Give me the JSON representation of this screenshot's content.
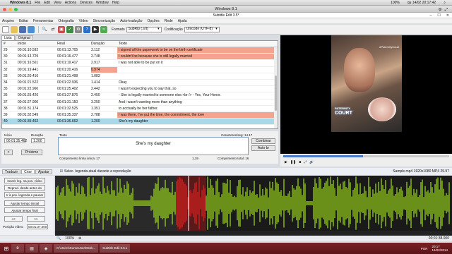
{
  "mac_menu": {
    "app": "Windows 8.1",
    "items": [
      "File",
      "Edit",
      "View",
      "Actions",
      "Devices",
      "Window",
      "Help"
    ],
    "clock": "qu 14/02 20:17:42",
    "battery": "100%"
  },
  "vm_title": "Windows 8.1",
  "window_title": "Subtitle Edit 3.5*",
  "menu": [
    "Arquivo",
    "Editar",
    "Ferramentas",
    "Ortografia",
    "Vídeo",
    "Sincronização",
    "Auto-tradução",
    "Opções",
    "Rede",
    "Ajuda"
  ],
  "toolbar": {
    "format_label": "Formato",
    "format_value": "SubRip (.srt)",
    "encoding_label": "Codificação",
    "encoding_value": "Unicode (UTF-8)"
  },
  "tabs": [
    "Lista",
    "Original"
  ],
  "grid": {
    "headers": [
      "#",
      "Início",
      "Final",
      "Duração",
      "Texto"
    ],
    "rows": [
      {
        "n": "29",
        "start": "00:01:10.592",
        "end": "00:01:13.705",
        "dur": "3.112",
        "text": "I signed all the paperwork to be on the birth certificate"
      },
      {
        "n": "30",
        "start": "00:01:13.729",
        "end": "00:01:16.477",
        "dur": "2.748",
        "text": "I couldn't be because she is still legally married"
      },
      {
        "n": "31",
        "start": "00:01:16.501",
        "end": "00:01:19.417",
        "dur": "2.917",
        "text": "I was not able to be put on it"
      },
      {
        "n": "32",
        "start": "00:01:19.441",
        "end": "00:01:20.416",
        "dur": "0.974",
        "text": ""
      },
      {
        "n": "33",
        "start": "00:01:20.416",
        "end": "00:01:21.498",
        "dur": "1.083",
        "text": ""
      },
      {
        "n": "34",
        "start": "00:01:21.522",
        "end": "00:01:22.936",
        "dur": "1.414",
        "text": "Okay"
      },
      {
        "n": "35",
        "start": "00:01:22.960",
        "end": "00:01:25.402",
        "dur": "2.442",
        "text": "I wasn't expecting you to say that, so"
      },
      {
        "n": "36",
        "start": "00:01:25.426",
        "end": "00:01:27.876",
        "dur": "2.450",
        "text": "- She is legally married to someone else.<br /> - Yes, Your Honor."
      },
      {
        "n": "37",
        "start": "00:01:27.900",
        "end": "00:01:31.150",
        "dur": "3.250",
        "text": "And i wasn't wanting more than anything"
      },
      {
        "n": "38",
        "start": "00:01:31.174",
        "end": "00:01:32.525",
        "dur": "1.351",
        "text": "to acctually be her father."
      },
      {
        "n": "39",
        "start": "00:01:32.549",
        "end": "00:01:35.337",
        "dur": "2.788",
        "text": "I was there, I've put the time, the commitment, the love"
      },
      {
        "n": "40",
        "start": "00:01:35.462",
        "end": "00:01:36.662",
        "dur": "1.200",
        "text": "She's my daughter"
      }
    ]
  },
  "editor": {
    "start_label": "Início",
    "start_value": "00:01:35.462",
    "dur_label": "Duração",
    "dur_value": "1.200",
    "text_label": "Texto",
    "text_value": "She's my daughter",
    "prev_button": "<",
    "next_button": "Próximo",
    "chars_label": "Caracteres/seg: 14.17",
    "len_total": "Comprimento linha única: 17",
    "line_len": "1,19",
    "total_len": "Comprimento total: 16",
    "combine_button": "Combinar",
    "auto_button": "Auto br"
  },
  "video": {
    "tag": "#PaternityCourt",
    "logo_top": "PATERNITY",
    "logo_bottom": "COURT"
  },
  "lower": {
    "tabs": [
      "Traduzir",
      "Criar",
      "Ajustar"
    ],
    "checkbox_label": "Selec. legenda atual durante a reprodução",
    "file_info": "Sample.mp4 1920x1080 MP4 29.97"
  },
  "side_buttons": [
    "Inserir leg. na pos. vídeo",
    "Reprod. desde antes do texto",
    "Ir à pos. legenda e pausar",
    "Ajustar tempo inicial",
    "Ajustar tempo final",
    "<<",
    ">>"
  ],
  "side_pos_label": "Posição vídeo:",
  "side_pos_value": "00:01:37.000",
  "zoom": {
    "level": "100%",
    "time": "00:01:38.000"
  },
  "taskbar": {
    "tasks": [
      "C:\\Users\\SomeUser\\Desk...",
      "Subtitle Edit 3.5.x"
    ],
    "lang": "POR",
    "time": "20:17",
    "date": "14/02/2014"
  }
}
